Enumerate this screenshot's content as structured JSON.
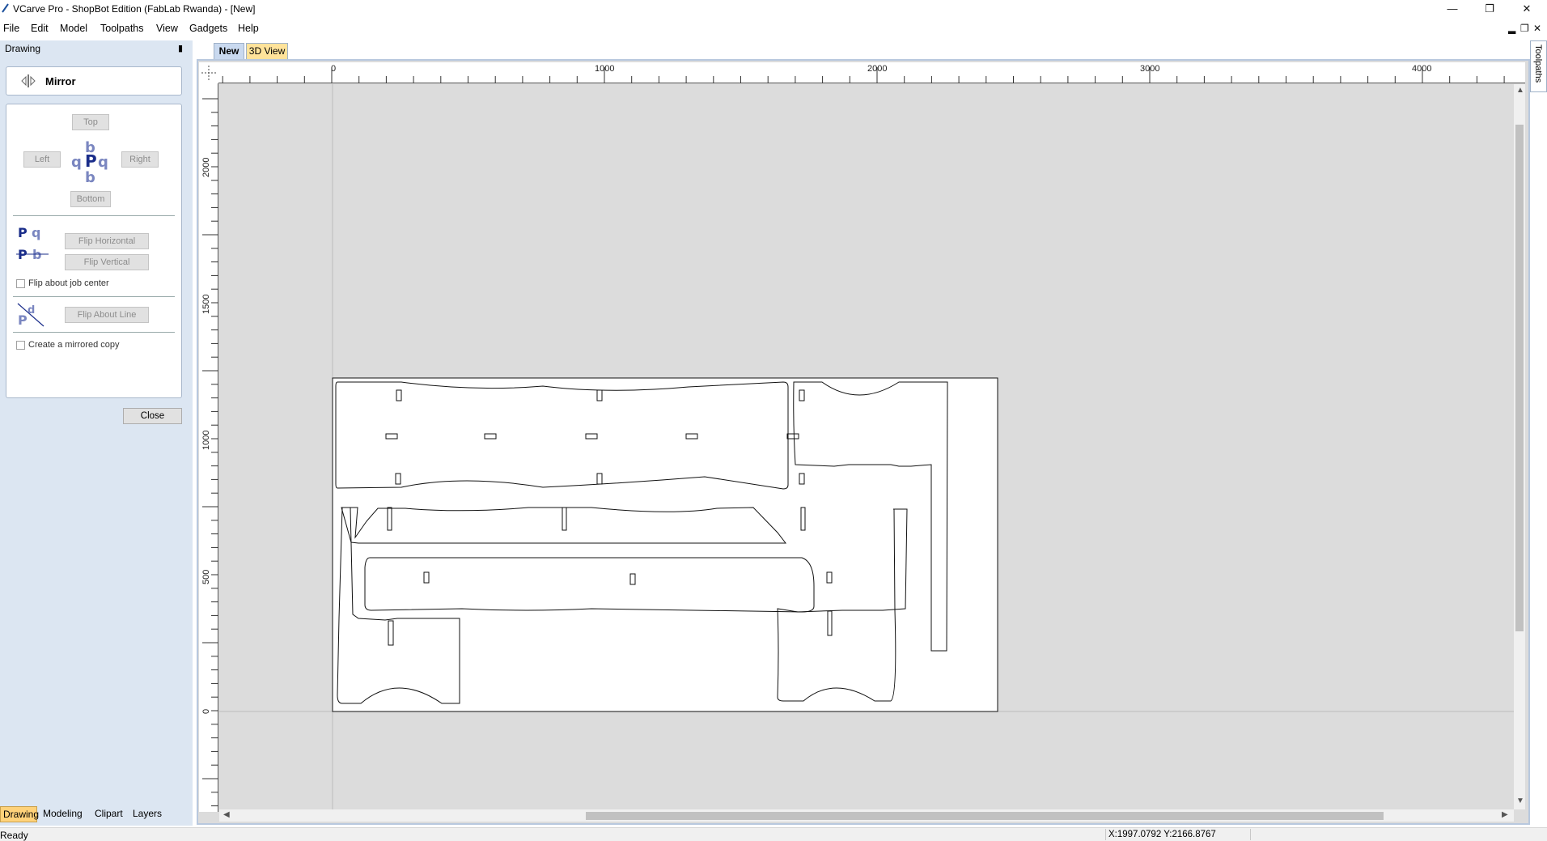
{
  "window": {
    "title": "VCarve Pro - ShopBot Edition (FabLab Rwanda) - [New]",
    "controls": [
      "minimize",
      "restore",
      "close"
    ]
  },
  "menu": [
    "File",
    "Edit",
    "Model",
    "Toolpaths",
    "View",
    "Gadgets",
    "Help"
  ],
  "panel": {
    "header": "Drawing",
    "tool_title": "Mirror",
    "buttons": {
      "top": "Top",
      "left": "Left",
      "right": "Right",
      "bottom": "Bottom",
      "flip_h": "Flip Horizontal",
      "flip_v": "Flip Vertical",
      "flip_line": "Flip About Line"
    },
    "checks": {
      "job_center": "Flip about job center",
      "mirrored_copy": "Create a mirrored copy"
    },
    "close": "Close"
  },
  "bottom_tabs": [
    "Drawing",
    "Modeling",
    "Clipart",
    "Layers"
  ],
  "doc_tabs": {
    "new": "New",
    "view3d": "3D View"
  },
  "side_tab": "Toolpaths",
  "rulers": {
    "h": [
      "0",
      "1000",
      "2000",
      "3000",
      "4000"
    ],
    "v": [
      "2000",
      "1500",
      "1000",
      "500",
      "0"
    ]
  },
  "status": {
    "left": "Ready",
    "coords": "X:1997.0792 Y:2166.8767"
  },
  "colors": {
    "panel_bg": "#dce6f2",
    "canvas_bg": "#dcdcdc",
    "active_tab": "#ffd27a",
    "doc_tab_new": "#c9d9ef"
  }
}
